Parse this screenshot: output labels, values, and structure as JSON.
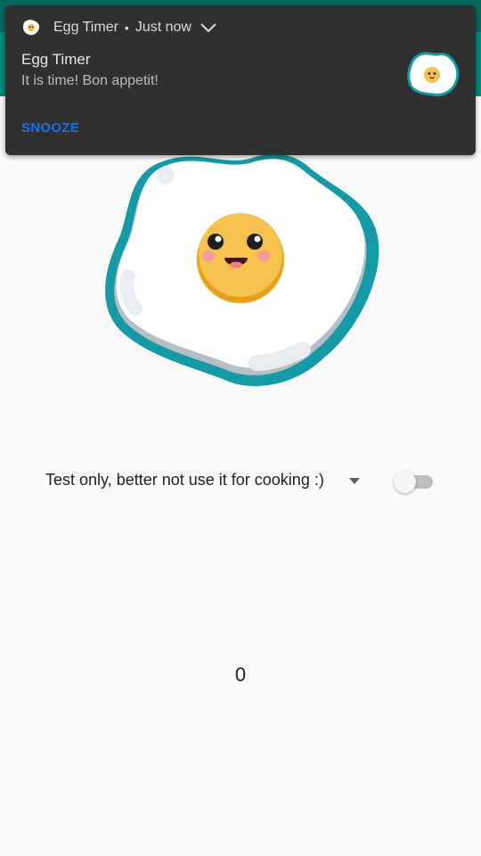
{
  "notification": {
    "app_name": "Egg Timer",
    "time": "Just now",
    "separator": "•",
    "title": "Egg Timer",
    "body": "It is time! Bon appetit!",
    "action_snooze": "SNOOZE",
    "app_icon": "fried-egg-icon"
  },
  "controls": {
    "spinner_selected": "Test only, better not use it for cooking :)",
    "switch_on": false
  },
  "timer": {
    "value": "0"
  },
  "colors": {
    "app_bar": "#00897b",
    "notification_bg": "#303030",
    "action_blue": "#1a73e8",
    "egg_outline": "#149aa6",
    "yolk": "#f6c04a"
  }
}
